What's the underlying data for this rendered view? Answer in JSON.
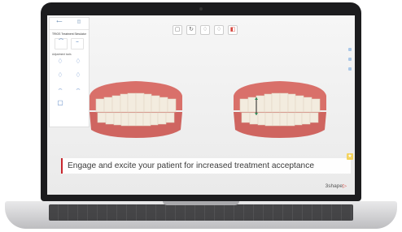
{
  "banner": {
    "text": "Engage and excite your patient for increased treatment acceptance"
  },
  "logo": {
    "text": "3shape",
    "mark": "▷"
  },
  "panel": {
    "tabs": [
      {
        "label": "",
        "icon": "back-icon"
      },
      {
        "label": "",
        "icon": "view-icon"
      }
    ],
    "title": "TRIOS Treatment Simulator",
    "mode_buttons": [
      {
        "label": "",
        "icon": "upper-jaw-icon"
      },
      {
        "label": "",
        "icon": "lower-jaw-icon"
      }
    ],
    "section_title": "Adjustment tools",
    "tools": [
      {
        "label": "",
        "icon": "tooth-move-icon"
      },
      {
        "label": "",
        "icon": "tooth-rotate-icon"
      },
      {
        "label": "",
        "icon": "tooth-tip-icon"
      },
      {
        "label": "",
        "icon": "tooth-torque-icon"
      },
      {
        "label": "",
        "icon": "arch-icon"
      },
      {
        "label": "",
        "icon": "arch-expand-icon"
      },
      {
        "label": "",
        "icon": "reset-icon"
      }
    ]
  },
  "toolbar": {
    "buttons": [
      {
        "icon": "view-front-icon",
        "glyph": "▢"
      },
      {
        "icon": "view-side-icon",
        "glyph": "↻"
      },
      {
        "icon": "tooth-icon",
        "glyph": "♢"
      },
      {
        "icon": "tooth-icon",
        "glyph": "♢"
      },
      {
        "icon": "compare-icon",
        "glyph": "◧"
      }
    ]
  },
  "colors": {
    "accent": "#c8262d",
    "gum": "#d9706a",
    "teeth": "#f3ecdf",
    "screen_bg": "#efefef"
  }
}
